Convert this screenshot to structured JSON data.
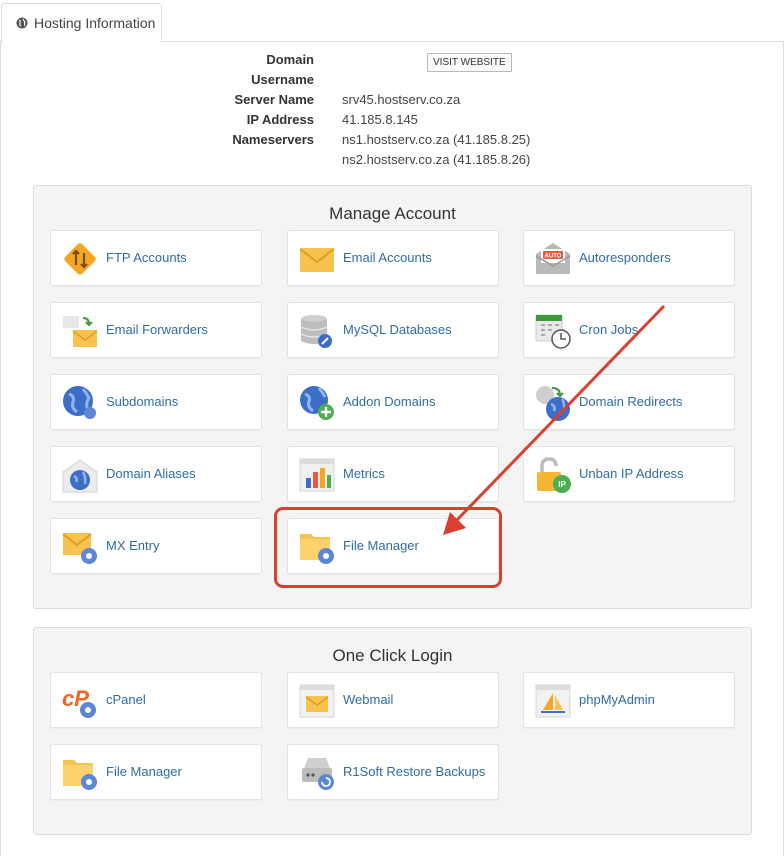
{
  "tab": {
    "label": "Hosting Information"
  },
  "info": {
    "domain_label": "Domain",
    "username_label": "Username",
    "server_label": "Server Name",
    "server_value": "srv45.hostserv.co.za",
    "ip_label": "IP Address",
    "ip_value": "41.185.8.145",
    "ns_label": "Nameservers",
    "ns1_value": "ns1.hostserv.co.za (41.185.8.25)",
    "ns2_value": "ns2.hostserv.co.za (41.185.8.26)",
    "visit_button": "VISIT WEBSITE"
  },
  "manage": {
    "title": "Manage Account",
    "items": [
      {
        "label": "FTP Accounts",
        "icon": "ftp-icon"
      },
      {
        "label": "Email Accounts",
        "icon": "envelope-icon"
      },
      {
        "label": "Autoresponders",
        "icon": "autoresponder-icon"
      },
      {
        "label": "Email Forwarders",
        "icon": "email-forward-icon"
      },
      {
        "label": "MySQL Databases",
        "icon": "database-icon"
      },
      {
        "label": "Cron Jobs",
        "icon": "calendar-clock-icon"
      },
      {
        "label": "Subdomains",
        "icon": "globe-icon"
      },
      {
        "label": "Addon Domains",
        "icon": "globe-plus-icon"
      },
      {
        "label": "Domain Redirects",
        "icon": "globe-redirect-icon"
      },
      {
        "label": "Domain Aliases",
        "icon": "globe-house-icon"
      },
      {
        "label": "Metrics",
        "icon": "bar-chart-icon"
      },
      {
        "label": "Unban IP Address",
        "icon": "padlock-ip-icon"
      },
      {
        "label": "MX Entry",
        "icon": "envelope-gear-icon"
      },
      {
        "label": "File Manager",
        "icon": "folder-gear-icon"
      }
    ]
  },
  "login": {
    "title": "One Click Login",
    "items": [
      {
        "label": "cPanel",
        "icon": "cpanel-icon"
      },
      {
        "label": "Webmail",
        "icon": "webmail-icon"
      },
      {
        "label": "phpMyAdmin",
        "icon": "phpmyadmin-icon"
      },
      {
        "label": "File Manager",
        "icon": "folder-gear-icon"
      },
      {
        "label": "R1Soft Restore Backups",
        "icon": "backup-drive-icon"
      }
    ]
  },
  "colors": {
    "accent": "#d9402f",
    "link": "#2e6da4",
    "panel_bg": "#f4f4f4"
  }
}
